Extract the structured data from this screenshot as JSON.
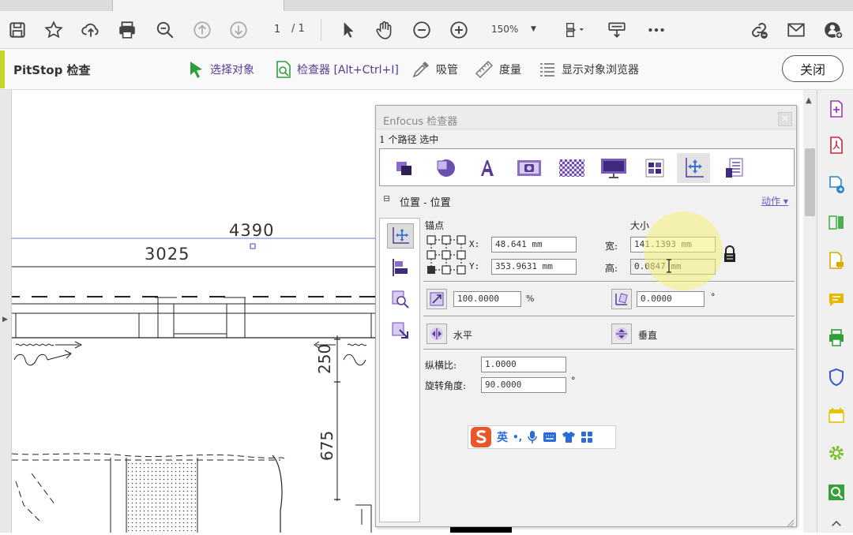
{
  "toolbar": {
    "page_current": "1",
    "page_total": "/ 1",
    "zoom": "150%"
  },
  "pitstop": {
    "title": "PitStop 检查",
    "select_object": "选择对象",
    "inspector": "检查器 [Alt+Ctrl+I]",
    "eyedropper": "吸管",
    "measure": "度量",
    "object_browser": "显示对象浏览器",
    "close": "关闭"
  },
  "drawing": {
    "dim_4390": "4390",
    "dim_3025": "3025",
    "dim_250": "250",
    "dim_675": "675"
  },
  "inspector": {
    "title": "Enfocus 检查器",
    "status": "1 个路径 选中",
    "section": "位置 - 位置",
    "actions": "动作",
    "anchor_label": "锚点",
    "size_label": "大小",
    "x_label": "X:",
    "x_value": "48.641 mm",
    "y_label": "Y:",
    "y_value": "353.9631 mm",
    "width_label": "宽:",
    "width_value": "141.1393 mm",
    "height_label": "高:",
    "height_value": "0.0847 mm",
    "scale_value": "100.0000",
    "scale_unit": "%",
    "rotate_value": "0.0000",
    "rotate_unit": "°",
    "flip_h": "水平",
    "flip_v": "垂直",
    "aspect_label": "纵横比:",
    "aspect_value": "1.0000",
    "rotation_label": "旋转角度:",
    "rotation_value": "90.0000",
    "rotation_unit": "°"
  },
  "ime": {
    "lang": "英",
    "punct": "•,"
  },
  "colors": {
    "accent_purple": "#5b3a96",
    "lime": "#c7d62d",
    "green": "#2f9e3a",
    "link_blue": "#6a5acd"
  }
}
